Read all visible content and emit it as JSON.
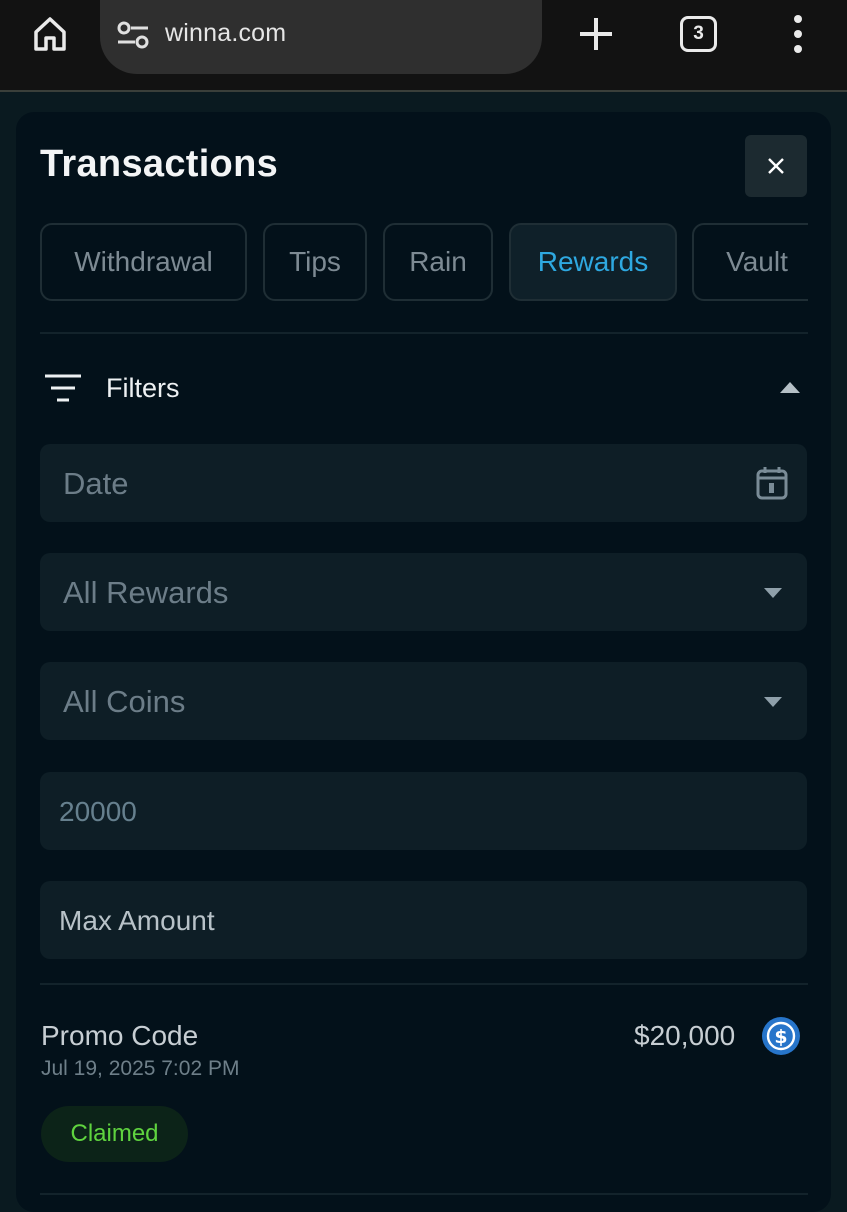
{
  "browser": {
    "url": "winna.com",
    "tab_count": "3"
  },
  "panel": {
    "title": "Transactions",
    "tabs": [
      {
        "label": "Withdrawal"
      },
      {
        "label": "Tips"
      },
      {
        "label": "Rain"
      },
      {
        "label": "Rewards",
        "active": true
      },
      {
        "label": "Vault"
      }
    ]
  },
  "filters": {
    "label": "Filters",
    "date_placeholder": "Date",
    "reward_type": "All Rewards",
    "coin": "All Coins",
    "min_amount": "20000",
    "max_amount_placeholder": "Max Amount"
  },
  "transactions": [
    {
      "name": "Promo Code",
      "date": "Jul 19, 2025 7:02 PM",
      "amount": "$20,000",
      "status": "Claimed",
      "coin_icon": "usdc-coin-icon"
    }
  ],
  "colors": {
    "accent": "#2ea8e0",
    "status_claimed": "#5fd33f",
    "panel_bg": "#03111a",
    "field_bg": "#0e1e26"
  }
}
